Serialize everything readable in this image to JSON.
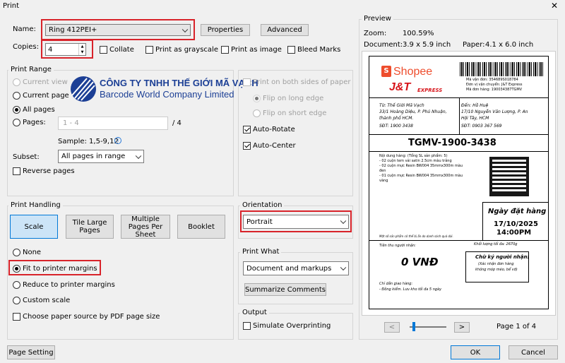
{
  "window": {
    "title": "Print"
  },
  "printer": {
    "name_label": "Name:",
    "name_value": "Ring 412PEI+",
    "properties": "Properties",
    "advanced": "Advanced",
    "copies_label": "Copies:",
    "copies_value": "4"
  },
  "options": {
    "collate": "Collate",
    "grayscale": "Print as grayscale",
    "as_image": "Print as image",
    "bleed": "Bleed Marks"
  },
  "range": {
    "title": "Print Range",
    "current_view": "Current view",
    "current_page": "Current page",
    "all_pages": "All pages",
    "pages": "Pages:",
    "pages_value": "1 - 4",
    "pages_total": "/ 4",
    "sample": "Sample: 1,5-9,12",
    "subset_label": "Subset:",
    "subset_value": "All pages in range",
    "reverse": "Reverse pages"
  },
  "logo": {
    "line1": "CÔNG TY TNHH THẾ GIỚI MÃ VẠCH",
    "line2": "Barcode World Company Limited"
  },
  "duplex": {
    "both_sides": "Print on both sides of paper",
    "long_edge": "Flip on long edge",
    "short_edge": "Flip on short edge",
    "auto_rotate": "Auto-Rotate",
    "auto_center": "Auto-Center"
  },
  "handling": {
    "title": "Print Handling",
    "scale": "Scale",
    "tile": "Tile Large Pages",
    "multiple": "Multiple Pages Per Sheet",
    "booklet": "Booklet",
    "none": "None",
    "fit": "Fit to printer margins",
    "reduce": "Reduce to printer margins",
    "custom": "Custom scale",
    "paper_source": "Choose paper source by PDF page size"
  },
  "orientation": {
    "title": "Orientation",
    "value": "Portrait"
  },
  "print_what": {
    "title": "Print What",
    "value": "Document and markups",
    "summarize": "Summarize Comments"
  },
  "output": {
    "title": "Output",
    "overprint": "Simulate Overprinting"
  },
  "preview": {
    "title": "Preview",
    "zoom_label": "Zoom:",
    "zoom_value": "100.59%",
    "document_label": "Document:",
    "document_value": "3.9 x 5.9 inch",
    "paper_label": "Paper:",
    "paper_value": "4.1 x 6.0 inch",
    "page_indicator": "Page 1 of 4",
    "prev": "<",
    "next": ">"
  },
  "label": {
    "shopee": "Shopee",
    "jt": "J&T",
    "jt_sub": "EXPRESS",
    "tracking_info": [
      "Mã vận đơn: 354689S018784",
      "Đơn vị vận chuyển: J&T Express",
      "Mã đơn hàng: 190034387TGMV"
    ],
    "from": [
      "Từ: Thế Giới Mã Vạch",
      "33/1 Hoàng Diệu, P. Phú Nhuận,",
      "thành phố HCM.",
      "SĐT: 1900 3438"
    ],
    "to": [
      "Đến: Hồ Huệ",
      "17/10 Nguyễn Văn Lượng, P. An",
      "Hội Tây, HCM",
      "SĐT: 0903 367 569"
    ],
    "code": "TGMV-1900-3438",
    "contents": [
      "Nội dung hàng: (Tổng SL sản phẩm: 5)",
      "- 02 cuộn tem vải satin 2.5cm màu trắng",
      "- 02 cuộn mực Resin BW004 35mmx300m  màu",
      "  đen",
      "- 01 cuộn mực Resin BW004 35mmx300m  màu",
      "  vàng"
    ],
    "note": "Một số sản phẩm có thể bị ẩn do danh sách quá dài.",
    "date_title": "Ngày đặt hàng",
    "date": "17/10/2025",
    "time": "14:00PM",
    "cod_label": "Tiền thu người nhận:",
    "cod_value": "0 VNĐ",
    "weight": "Khối lượng tối đa: 2670g",
    "sign_title": "Chữ ký người nhận:",
    "sign_note": [
      "(Xác nhận đơn hàng",
      "không móp méo, bể vỡ)"
    ],
    "instr": [
      "Chỉ dẫn giao hàng:",
      "- Đồng kiểm. Lưu kho tối đa 5 ngày"
    ]
  },
  "footer": {
    "page_setting": "Page Setting",
    "ok": "OK",
    "cancel": "Cancel"
  },
  "colors": {
    "accent": "#d8232a",
    "shopee": "#ee4d2d",
    "jt": "#d7141a",
    "selected_button": "#cce4f7"
  }
}
